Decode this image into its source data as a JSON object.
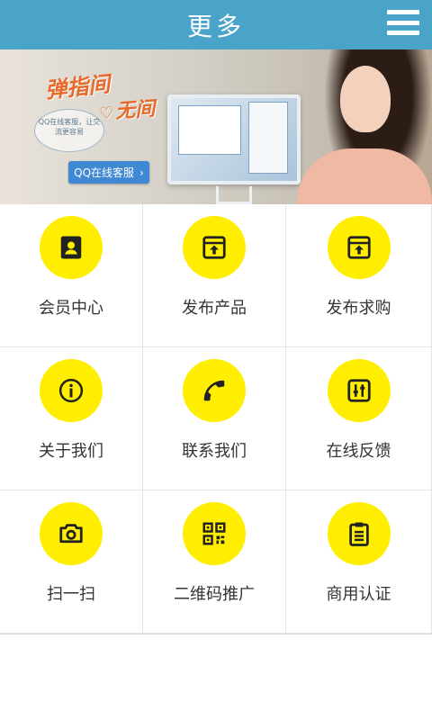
{
  "header": {
    "title": "更多"
  },
  "banner": {
    "title": "弹指间",
    "subtitle": "无间",
    "bubble_text": "QQ在线客服，让交流更容易",
    "button_label": "QQ在线客服",
    "button_chevron": "›"
  },
  "grid": {
    "accent_color": "#ffee00",
    "items": [
      {
        "label": "会员中心",
        "icon": "member-icon"
      },
      {
        "label": "发布产品",
        "icon": "publish-product-icon"
      },
      {
        "label": "发布求购",
        "icon": "publish-purchase-icon"
      },
      {
        "label": "关于我们",
        "icon": "info-icon"
      },
      {
        "label": "联系我们",
        "icon": "phone-icon"
      },
      {
        "label": "在线反馈",
        "icon": "feedback-icon"
      },
      {
        "label": "扫一扫",
        "icon": "camera-icon"
      },
      {
        "label": "二维码推广",
        "icon": "qr-code-icon"
      },
      {
        "label": "商用认证",
        "icon": "clipboard-icon"
      }
    ]
  },
  "colors": {
    "header": "#4aa3c8",
    "icon_bg": "#ffee00"
  }
}
